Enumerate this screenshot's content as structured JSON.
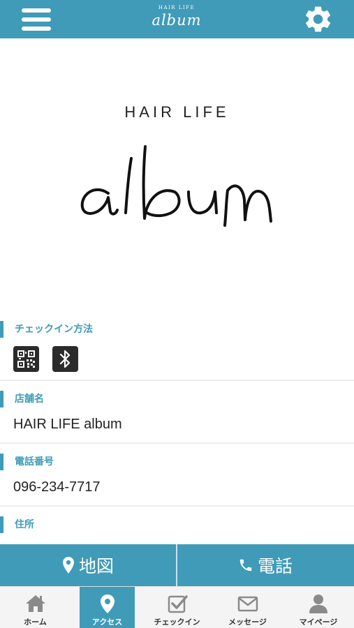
{
  "header": {
    "logo_small": "HAIR LIFE",
    "logo_script": "album",
    "menu_icon": "hamburger-menu-icon",
    "settings_icon": "gear-icon"
  },
  "hero": {
    "subtitle": "HAIR LIFE",
    "script_text": "album"
  },
  "sections": {
    "checkin": {
      "label": "チェックイン方法",
      "icons": [
        "qr-code-icon",
        "bluetooth-icon"
      ]
    },
    "shop_name": {
      "label": "店舗名",
      "value": "HAIR LIFE album"
    },
    "phone": {
      "label": "電話番号",
      "value": "096-234-7717"
    },
    "address": {
      "label": "住所"
    }
  },
  "actions": {
    "map_label": "地図",
    "call_label": "電話"
  },
  "bottom_nav": {
    "items": [
      {
        "label": "ホーム",
        "icon": "home-icon"
      },
      {
        "label": "アクセス",
        "icon": "map-pin-icon"
      },
      {
        "label": "チェックイン",
        "icon": "check-icon"
      },
      {
        "label": "メッセージ",
        "icon": "mail-icon"
      },
      {
        "label": "マイページ",
        "icon": "user-icon"
      }
    ],
    "active_index": 1
  },
  "colors": {
    "accent": "#3f9bb8",
    "nav_background": "#f4f4f4"
  }
}
